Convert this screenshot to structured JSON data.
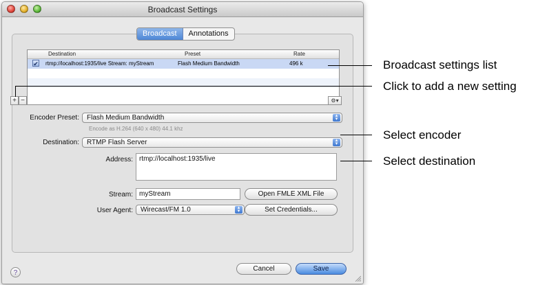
{
  "window": {
    "title": "Broadcast Settings"
  },
  "tabs": [
    {
      "label": "Broadcast",
      "active": true
    },
    {
      "label": "Annotations",
      "active": false
    }
  ],
  "list": {
    "columns": [
      "Destination",
      "Preset",
      "Rate"
    ],
    "rows": [
      {
        "checked": true,
        "destination": "rtmp://localhost:1935/live Stream: myStream",
        "preset": "Flash Medium Bandwidth",
        "rate": "496 k"
      }
    ],
    "add_label": "+",
    "remove_label": "−",
    "gear_label": "⚙▾"
  },
  "encoder": {
    "label": "Encoder Preset:",
    "value": "Flash Medium Bandwidth",
    "hint": "Encode as H.264 (640 x 480) 44.1 khz"
  },
  "destination": {
    "label": "Destination:",
    "value": "RTMP Flash Server"
  },
  "address": {
    "label": "Address:",
    "value": "rtmp://localhost:1935/live"
  },
  "stream": {
    "label": "Stream:",
    "value": "myStream"
  },
  "user_agent": {
    "label": "User Agent:",
    "value": "Wirecast/FM 1.0"
  },
  "buttons": {
    "open_fmle": "Open FMLE XML File",
    "set_credentials": "Set Credentials...",
    "cancel": "Cancel",
    "save": "Save",
    "help": "?"
  },
  "callouts": [
    "Broadcast settings list",
    "Click to add a new setting",
    "Select encoder",
    "Select destination"
  ],
  "colors": {
    "accent": "#4d86d6",
    "selection": "#c9d8f4"
  }
}
